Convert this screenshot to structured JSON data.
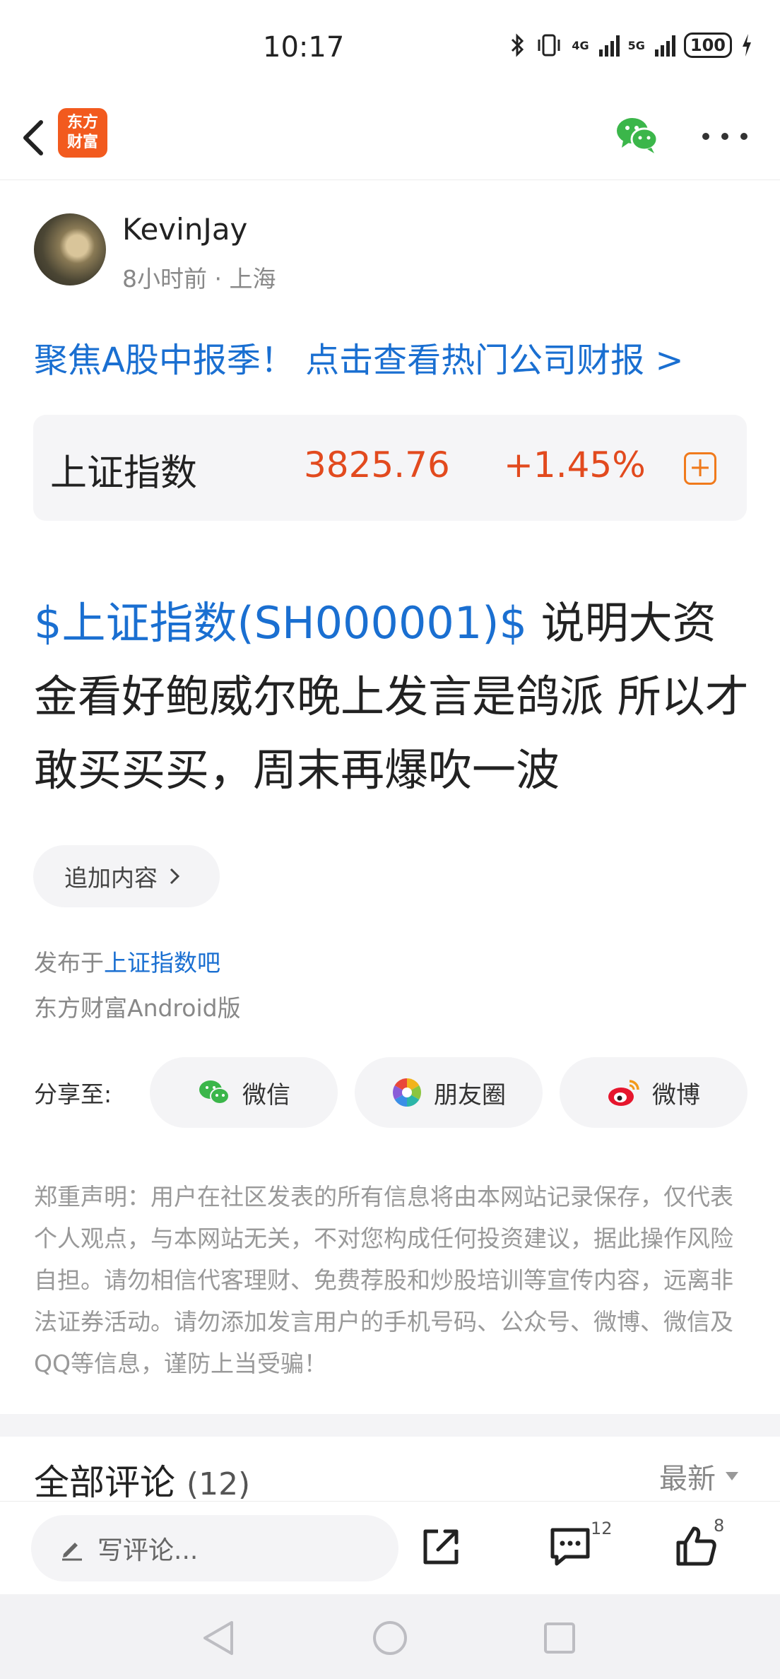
{
  "status_bar": {
    "time": "10:17",
    "net1": "4G",
    "net2": "5G",
    "battery": "100"
  },
  "header": {
    "logo_line1": "东方",
    "logo_line2": "财富"
  },
  "author": {
    "name": "KevinJay",
    "meta": "8小时前 · 上海"
  },
  "promo": "聚焦A股中报季！ 点击查看热门公司财报 >",
  "stock": {
    "name": "上证指数",
    "price": "3825.76",
    "change": "+1.45%",
    "add_label": "+"
  },
  "post": {
    "tag": "$上证指数(SH000001)$",
    "text": " 说明大资金看好鲍威尔晚上发言是鸽派 所以才敢买买买，周末再爆吹一波"
  },
  "append_label": "追加内容",
  "published": {
    "prefix": "发布于",
    "bar": "上证指数吧",
    "client": "东方财富Android版"
  },
  "share": {
    "label": "分享至:",
    "wechat": "微信",
    "moments": "朋友圈",
    "weibo": "微博"
  },
  "disclaimer": "郑重声明：用户在社区发表的所有信息将由本网站记录保存，仅代表个人观点，与本网站无关，不对您构成任何投资建议，据此操作风险自担。请勿相信代客理财、免费荐股和炒股培训等宣传内容，远离非法证券活动。请勿添加发言用户的手机号码、公众号、微博、微信及QQ等信息，谨防上当受骗！",
  "comments": {
    "title": "全部评论",
    "count": "(12)",
    "sort": "最新"
  },
  "bottom_bar": {
    "placeholder": "写评论...",
    "comment_count": "12",
    "like_count": "8"
  },
  "colors": {
    "link_blue": "#1a6fd1",
    "rise_red": "#e24a1e",
    "brand_orange": "#f25a1e",
    "wechat_green": "#3bb64a"
  },
  "icons": [
    "back-icon",
    "wechat-icon",
    "more-icon",
    "add-stock-icon",
    "chevron-right-icon",
    "moments-icon",
    "weibo-icon",
    "pencil-icon",
    "share-out-icon",
    "comment-icon",
    "like-icon",
    "nav-back-icon",
    "nav-home-icon",
    "nav-recents-icon"
  ]
}
